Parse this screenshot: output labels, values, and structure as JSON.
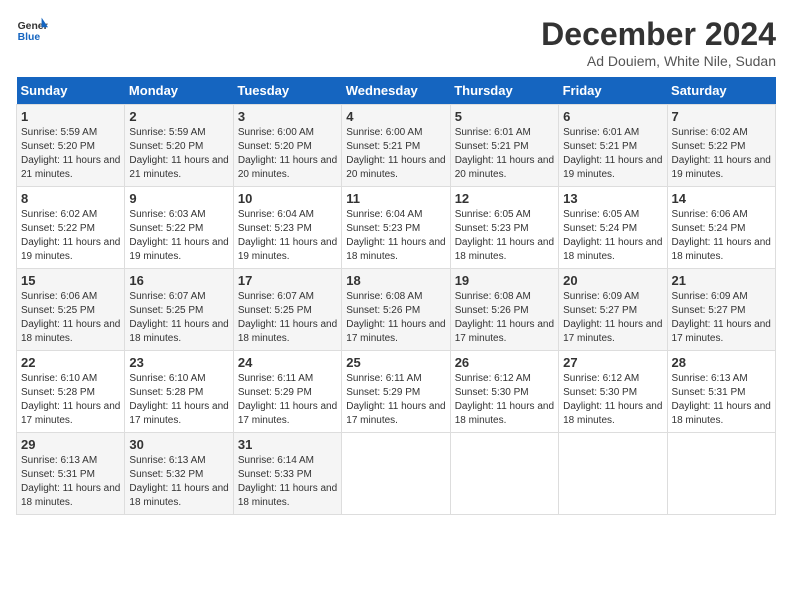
{
  "logo": {
    "general": "General",
    "blue": "Blue"
  },
  "title": "December 2024",
  "subtitle": "Ad Douiem, White Nile, Sudan",
  "weekdays": [
    "Sunday",
    "Monday",
    "Tuesday",
    "Wednesday",
    "Thursday",
    "Friday",
    "Saturday"
  ],
  "weeks": [
    [
      {
        "day": "1",
        "sunrise": "5:59 AM",
        "sunset": "5:20 PM",
        "daylight": "11 hours and 21 minutes."
      },
      {
        "day": "2",
        "sunrise": "5:59 AM",
        "sunset": "5:20 PM",
        "daylight": "11 hours and 21 minutes."
      },
      {
        "day": "3",
        "sunrise": "6:00 AM",
        "sunset": "5:20 PM",
        "daylight": "11 hours and 20 minutes."
      },
      {
        "day": "4",
        "sunrise": "6:00 AM",
        "sunset": "5:21 PM",
        "daylight": "11 hours and 20 minutes."
      },
      {
        "day": "5",
        "sunrise": "6:01 AM",
        "sunset": "5:21 PM",
        "daylight": "11 hours and 20 minutes."
      },
      {
        "day": "6",
        "sunrise": "6:01 AM",
        "sunset": "5:21 PM",
        "daylight": "11 hours and 19 minutes."
      },
      {
        "day": "7",
        "sunrise": "6:02 AM",
        "sunset": "5:22 PM",
        "daylight": "11 hours and 19 minutes."
      }
    ],
    [
      {
        "day": "8",
        "sunrise": "6:02 AM",
        "sunset": "5:22 PM",
        "daylight": "11 hours and 19 minutes."
      },
      {
        "day": "9",
        "sunrise": "6:03 AM",
        "sunset": "5:22 PM",
        "daylight": "11 hours and 19 minutes."
      },
      {
        "day": "10",
        "sunrise": "6:04 AM",
        "sunset": "5:23 PM",
        "daylight": "11 hours and 19 minutes."
      },
      {
        "day": "11",
        "sunrise": "6:04 AM",
        "sunset": "5:23 PM",
        "daylight": "11 hours and 18 minutes."
      },
      {
        "day": "12",
        "sunrise": "6:05 AM",
        "sunset": "5:23 PM",
        "daylight": "11 hours and 18 minutes."
      },
      {
        "day": "13",
        "sunrise": "6:05 AM",
        "sunset": "5:24 PM",
        "daylight": "11 hours and 18 minutes."
      },
      {
        "day": "14",
        "sunrise": "6:06 AM",
        "sunset": "5:24 PM",
        "daylight": "11 hours and 18 minutes."
      }
    ],
    [
      {
        "day": "15",
        "sunrise": "6:06 AM",
        "sunset": "5:25 PM",
        "daylight": "11 hours and 18 minutes."
      },
      {
        "day": "16",
        "sunrise": "6:07 AM",
        "sunset": "5:25 PM",
        "daylight": "11 hours and 18 minutes."
      },
      {
        "day": "17",
        "sunrise": "6:07 AM",
        "sunset": "5:25 PM",
        "daylight": "11 hours and 18 minutes."
      },
      {
        "day": "18",
        "sunrise": "6:08 AM",
        "sunset": "5:26 PM",
        "daylight": "11 hours and 17 minutes."
      },
      {
        "day": "19",
        "sunrise": "6:08 AM",
        "sunset": "5:26 PM",
        "daylight": "11 hours and 17 minutes."
      },
      {
        "day": "20",
        "sunrise": "6:09 AM",
        "sunset": "5:27 PM",
        "daylight": "11 hours and 17 minutes."
      },
      {
        "day": "21",
        "sunrise": "6:09 AM",
        "sunset": "5:27 PM",
        "daylight": "11 hours and 17 minutes."
      }
    ],
    [
      {
        "day": "22",
        "sunrise": "6:10 AM",
        "sunset": "5:28 PM",
        "daylight": "11 hours and 17 minutes."
      },
      {
        "day": "23",
        "sunrise": "6:10 AM",
        "sunset": "5:28 PM",
        "daylight": "11 hours and 17 minutes."
      },
      {
        "day": "24",
        "sunrise": "6:11 AM",
        "sunset": "5:29 PM",
        "daylight": "11 hours and 17 minutes."
      },
      {
        "day": "25",
        "sunrise": "6:11 AM",
        "sunset": "5:29 PM",
        "daylight": "11 hours and 17 minutes."
      },
      {
        "day": "26",
        "sunrise": "6:12 AM",
        "sunset": "5:30 PM",
        "daylight": "11 hours and 18 minutes."
      },
      {
        "day": "27",
        "sunrise": "6:12 AM",
        "sunset": "5:30 PM",
        "daylight": "11 hours and 18 minutes."
      },
      {
        "day": "28",
        "sunrise": "6:13 AM",
        "sunset": "5:31 PM",
        "daylight": "11 hours and 18 minutes."
      }
    ],
    [
      {
        "day": "29",
        "sunrise": "6:13 AM",
        "sunset": "5:31 PM",
        "daylight": "11 hours and 18 minutes."
      },
      {
        "day": "30",
        "sunrise": "6:13 AM",
        "sunset": "5:32 PM",
        "daylight": "11 hours and 18 minutes."
      },
      {
        "day": "31",
        "sunrise": "6:14 AM",
        "sunset": "5:33 PM",
        "daylight": "11 hours and 18 minutes."
      },
      null,
      null,
      null,
      null
    ]
  ]
}
